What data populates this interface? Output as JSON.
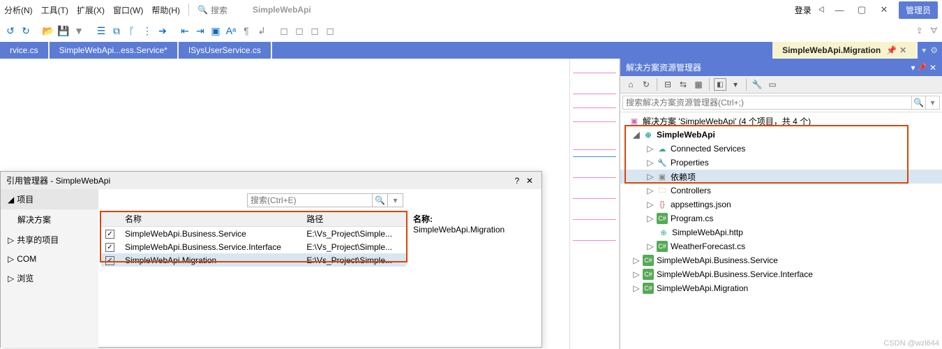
{
  "menu": {
    "items": [
      "分析(N)",
      "工具(T)",
      "扩展(X)",
      "窗口(W)",
      "帮助(H)"
    ],
    "search_label": "搜索",
    "app_title": "SimpleWebApi",
    "login": "登录",
    "admin": "管理员"
  },
  "tabs": [
    {
      "label": "rvice.cs"
    },
    {
      "label": "SimpleWebApi...ess.Service*"
    },
    {
      "label": "ISysUserService.cs"
    }
  ],
  "active_tab": {
    "label": "SimpleWebApi.Migration"
  },
  "explorer": {
    "title": "解决方案资源管理器",
    "search_placeholder": "搜索解决方案资源管理器(Ctrl+;)",
    "solution_label": "解决方案 'SimpleWebApi' (4 个项目，共 4 个)",
    "proj_main": "SimpleWebApi",
    "nodes": {
      "connected": "Connected Services",
      "properties": "Properties",
      "deps": "依赖项",
      "controllers": "Controllers",
      "appsettings": "appsettings.json",
      "program": "Program.cs",
      "http": "SimpleWebApi.http",
      "weather": "WeatherForecast.cs",
      "biz_service": "SimpleWebApi.Business.Service",
      "biz_iface": "SimpleWebApi.Business.Service.Interface",
      "migration": "SimpleWebApi.Migration"
    }
  },
  "dialog": {
    "title": "引用管理器 - SimpleWebApi",
    "nav": {
      "project": "项目",
      "solution": "解决方案",
      "shared": "共享的项目",
      "com": "COM",
      "browse": "浏览"
    },
    "search_placeholder": "搜索(Ctrl+E)",
    "columns": {
      "name": "名称",
      "path": "路径"
    },
    "rows": [
      {
        "checked": true,
        "name": "SimpleWebApi.Business.Service",
        "path": "E:\\Vs_Project\\Simple..."
      },
      {
        "checked": true,
        "name": "SimpleWebApi.Business.Service.Interface",
        "path": "E:\\Vs_Project\\Simple..."
      },
      {
        "checked": true,
        "name": "SimpleWebApi.Migration",
        "path": "E:\\Vs_Project\\Simple..."
      }
    ],
    "detail_label": "名称:",
    "detail_value": "SimpleWebApi.Migration"
  },
  "watermark": "CSDN @wzl644"
}
